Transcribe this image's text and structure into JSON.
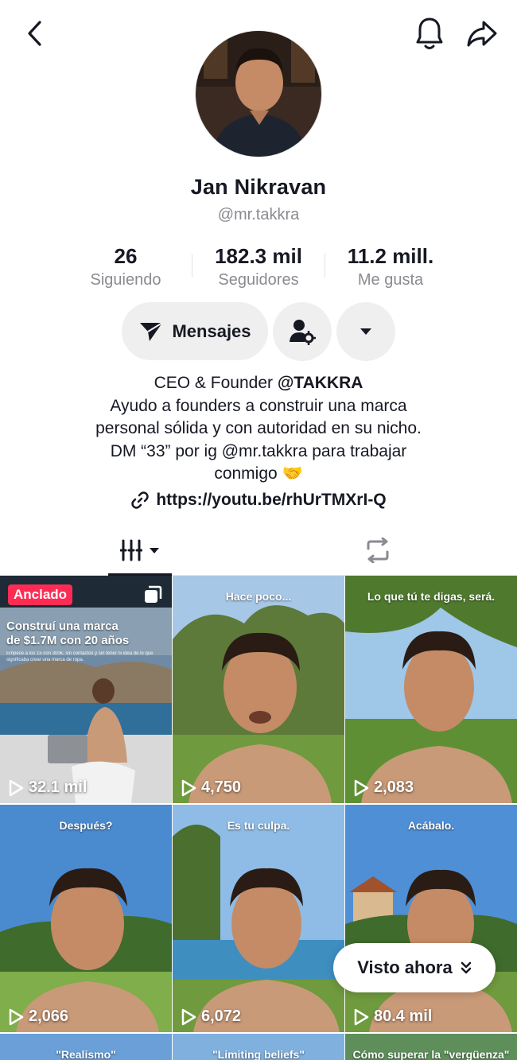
{
  "profile": {
    "name": "Jan Nikravan",
    "handle": "@mr.takkra"
  },
  "stats": {
    "following": {
      "value": "26",
      "label": "Siguiendo"
    },
    "followers": {
      "value": "182.3 mil",
      "label": "Seguidores"
    },
    "likes": {
      "value": "11.2 mill.",
      "label": "Me gusta"
    }
  },
  "actions": {
    "message_label": "Mensajes"
  },
  "bio": {
    "line1_prefix": "CEO & Founder ",
    "line1_mention": "@TAKKRA",
    "line2": "Ayudo a founders a construir una marca",
    "line3": "personal sólida y con autoridad en su nicho.",
    "line4": "DM “33” por ig @mr.takkra para trabajar",
    "line5": "conmigo 🤝",
    "link": "https://youtu.be/rhUrTMXrI-Q"
  },
  "tabs": {
    "videos_icon": "videos-grid-icon",
    "reposts_icon": "repost-icon"
  },
  "videos": [
    {
      "views": "32.1 mil",
      "pinned_label": "Anclado",
      "headline_1": "Construí una marca",
      "headline_2": "de $1.7M con 20 años",
      "sub": "Empecé a los 15 con 300€, sin contactos y sin tener ni idea de lo que significaba crear una marca de ropa."
    },
    {
      "views": "4,750",
      "overlay": "Hace poco..."
    },
    {
      "views": "2,083",
      "overlay": "Lo que tú te digas, será."
    },
    {
      "views": "2,066",
      "overlay": "Después?"
    },
    {
      "views": "6,072",
      "overlay": "Es tu culpa."
    },
    {
      "views": "80.4 mil",
      "overlay": "Acábalo."
    },
    {
      "overlay": "\"Realismo\""
    },
    {
      "overlay": "\"Limiting beliefs\""
    },
    {
      "overlay": "Cómo superar la \"vergüenza\""
    }
  ],
  "visto": {
    "label": "Visto ahora"
  },
  "colors": {
    "accent": "#fe2c55",
    "text": "#161823",
    "muted": "#8a8b91",
    "button_bg": "#efefef"
  }
}
